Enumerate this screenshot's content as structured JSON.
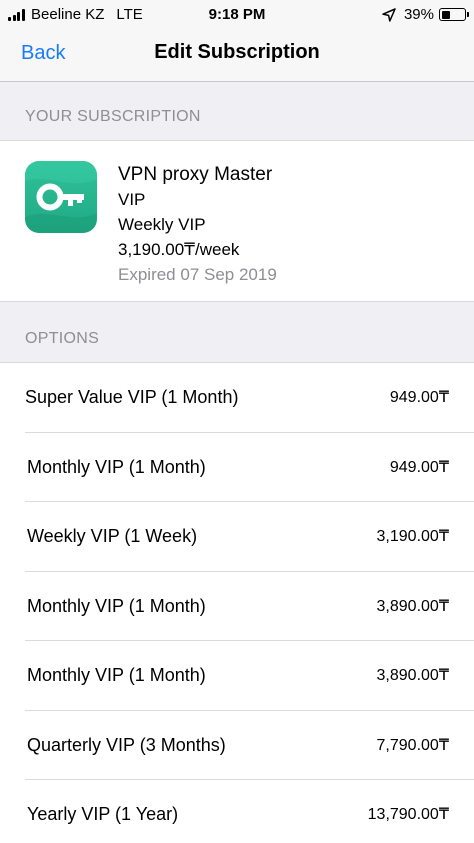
{
  "status_bar": {
    "carrier": "Beeline KZ",
    "network": "LTE",
    "time": "9:18 PM",
    "battery_percent": "39%",
    "battery_level": 0.39
  },
  "nav": {
    "back_label": "Back",
    "title": "Edit Subscription"
  },
  "your_subscription": {
    "header": "YOUR SUBSCRIPTION",
    "app_name": "VPN proxy Master",
    "app_subtitle": "VIP",
    "plan": "Weekly VIP",
    "price": "3,190.00₸/week",
    "status": "Expired 07 Sep 2019",
    "icon": "key-icon",
    "icon_color": "#27b68e"
  },
  "options": {
    "header": "OPTIONS",
    "items": [
      {
        "label": "Super Value VIP (1 Month)",
        "price": "949.00₸"
      },
      {
        "label": "Monthly VIP (1 Month)",
        "price": "949.00₸"
      },
      {
        "label": "Weekly VIP (1 Week)",
        "price": "3,190.00₸"
      },
      {
        "label": "Monthly VIP (1 Month)",
        "price": "3,890.00₸"
      },
      {
        "label": "Monthly VIP (1 Month)",
        "price": "3,890.00₸"
      },
      {
        "label": "Quarterly VIP (3 Months)",
        "price": "7,790.00₸"
      },
      {
        "label": "Yearly VIP (1 Year)",
        "price": "13,790.00₸"
      }
    ]
  },
  "colors": {
    "accent": "#1a7cf5",
    "secondary_text": "#8e8e93",
    "grouped_background": "#efeff4"
  }
}
